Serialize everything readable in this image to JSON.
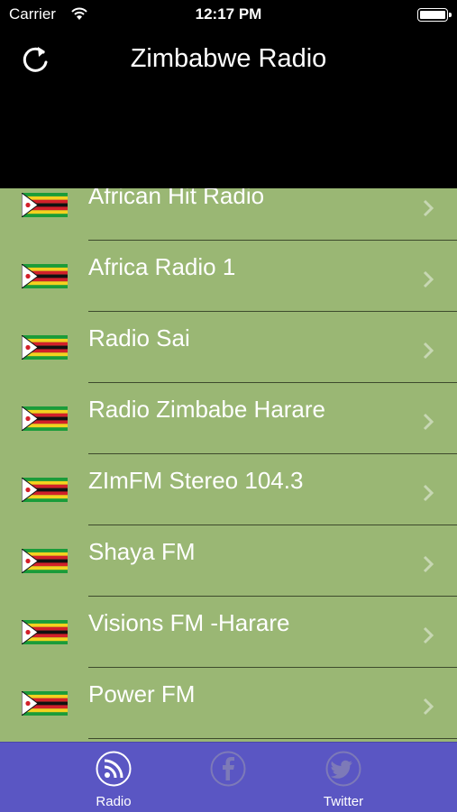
{
  "status_bar": {
    "carrier": "Carrier",
    "time": "12:17 PM"
  },
  "header": {
    "title": "Zimbabwe Radio",
    "refresh_icon": "refresh-icon"
  },
  "stations": [
    {
      "name": "African Hit Radio"
    },
    {
      "name": "Africa Radio 1"
    },
    {
      "name": "Radio Sai"
    },
    {
      "name": "Radio Zimbabe Harare"
    },
    {
      "name": "ZImFM Stereo 104.3"
    },
    {
      "name": "Shaya FM"
    },
    {
      "name": "Visions FM -Harare"
    },
    {
      "name": "Power FM"
    }
  ],
  "tabs": [
    {
      "label": "Radio",
      "icon": "rss-icon",
      "selected": true
    },
    {
      "label": "",
      "icon": "facebook-icon",
      "selected": false
    },
    {
      "label": "Twitter",
      "icon": "twitter-icon",
      "selected": false
    }
  ],
  "colors": {
    "header_bg": "#000000",
    "list_bg": "#9ab774",
    "tabbar_bg": "#5a56c3",
    "separator": "#3d4a2c"
  }
}
